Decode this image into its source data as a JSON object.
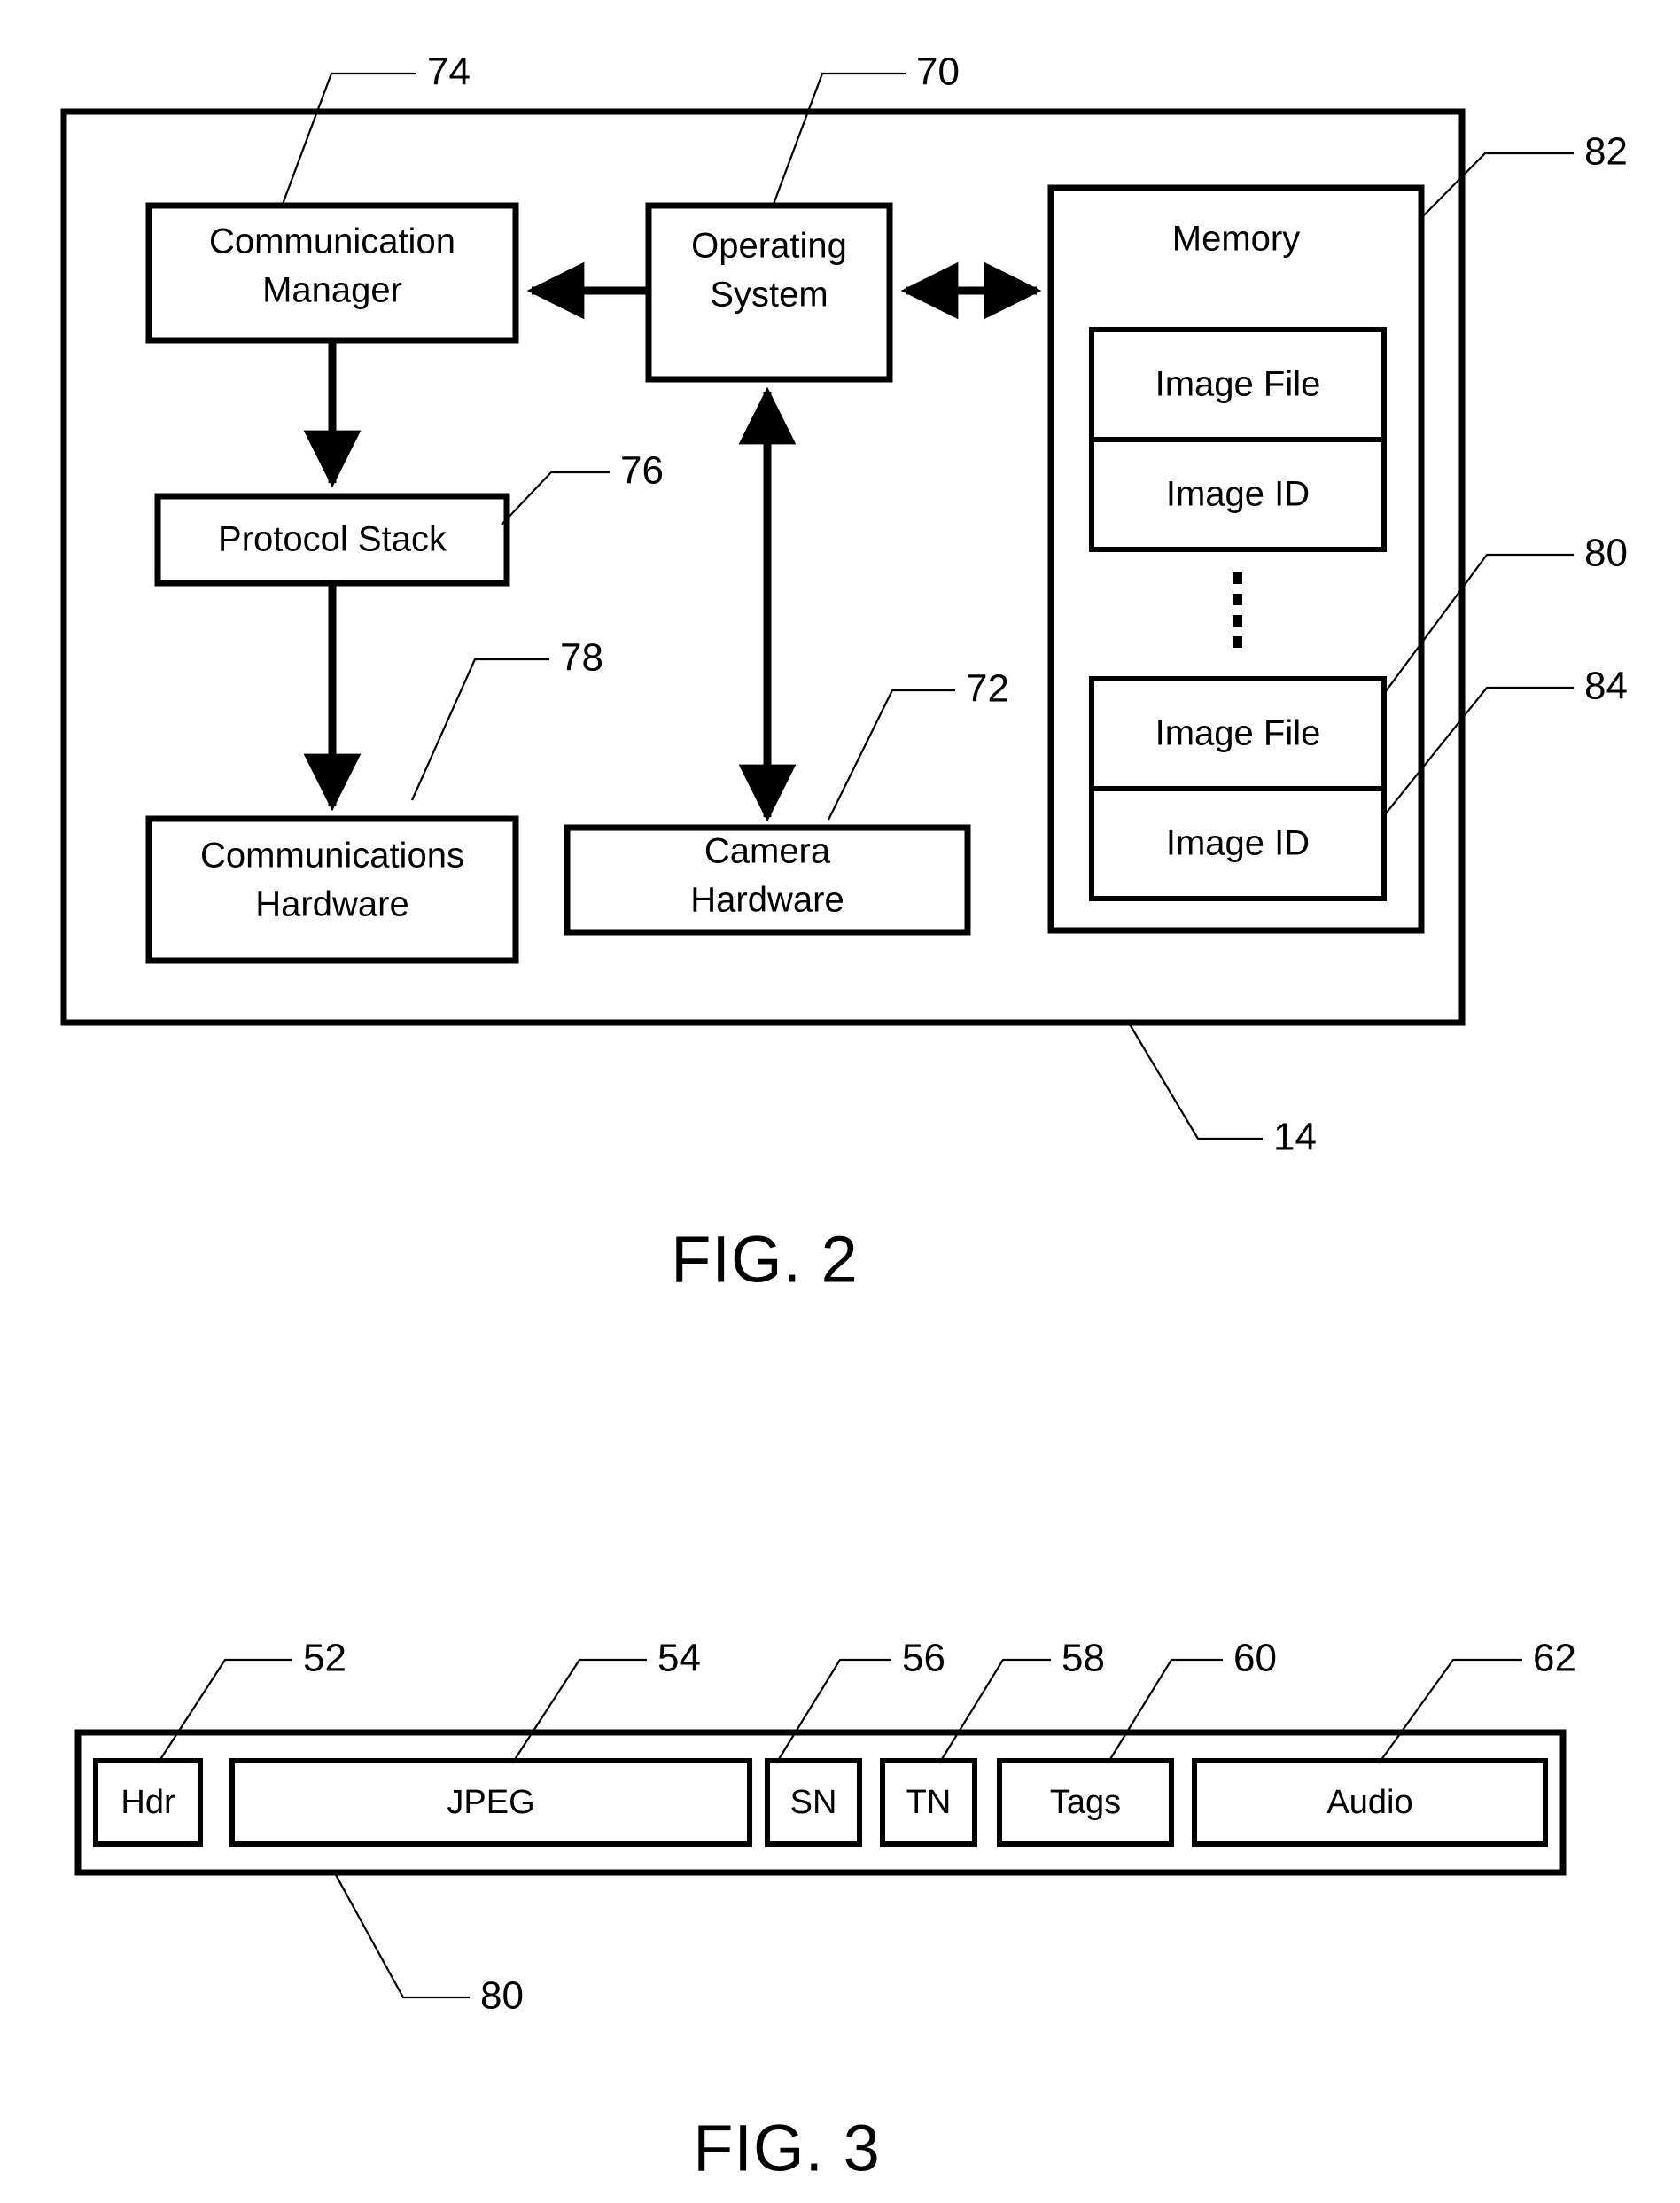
{
  "figures": [
    {
      "caption": "FIG. 2",
      "device_ref": "14",
      "blocks": {
        "communication_manager": {
          "line1": "Communication",
          "line2": "Manager",
          "ref": "74"
        },
        "operating_system": {
          "line1": "Operating",
          "line2": "System",
          "ref": "70"
        },
        "protocol_stack": {
          "line1": "Protocol Stack",
          "ref": "76"
        },
        "communications_hardware": {
          "line1": "Communications",
          "line2": "Hardware",
          "ref": "78"
        },
        "camera_hardware": {
          "line1": "Camera",
          "line2": "Hardware",
          "ref": "72"
        },
        "memory": {
          "title": "Memory",
          "ref": "82"
        }
      },
      "memory_records": [
        {
          "file_label": "Image File",
          "id_label": "Image ID"
        },
        {
          "file_label": "Image File",
          "id_label": "Image ID"
        }
      ],
      "memory_record_refs": {
        "image_file": "80",
        "image_id": "84"
      }
    },
    {
      "caption": "FIG. 3",
      "container_ref": "80",
      "segments": [
        {
          "label": "Hdr",
          "ref": "52"
        },
        {
          "label": "JPEG",
          "ref": "54"
        },
        {
          "label": "SN",
          "ref": "56"
        },
        {
          "label": "TN",
          "ref": "58"
        },
        {
          "label": "Tags",
          "ref": "60"
        },
        {
          "label": "Audio",
          "ref": "62"
        }
      ]
    }
  ]
}
